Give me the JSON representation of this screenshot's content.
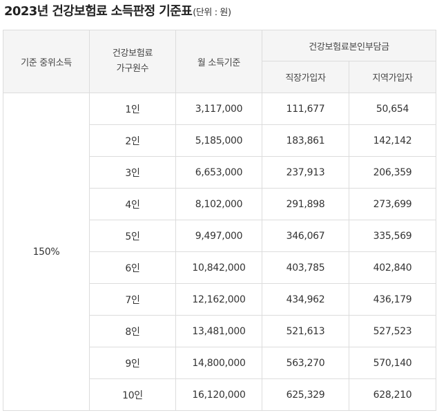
{
  "title": {
    "main": "2023년 건강보험료 소득판정 기준표",
    "unit": "(단위 : 원)"
  },
  "table": {
    "headers": {
      "median_income": "기준 중위소득",
      "household_line1": "건강보험료",
      "household_line2": "가구원수",
      "monthly_income": "월 소득기준",
      "premium_group": "건강보험료본인부담금",
      "employee": "직장가입자",
      "regional": "지역가입자"
    },
    "median_value": "150%",
    "rows": [
      {
        "members": "1인",
        "income": "3,117,000",
        "employee": "111,677",
        "regional": "50,654"
      },
      {
        "members": "2인",
        "income": "5,185,000",
        "employee": "183,861",
        "regional": "142,142"
      },
      {
        "members": "3인",
        "income": "6,653,000",
        "employee": "237,913",
        "regional": "206,359"
      },
      {
        "members": "4인",
        "income": "8,102,000",
        "employee": "291,898",
        "regional": "273,699"
      },
      {
        "members": "5인",
        "income": "9,497,000",
        "employee": "346,067",
        "regional": "335,569"
      },
      {
        "members": "6인",
        "income": "10,842,000",
        "employee": "403,785",
        "regional": "402,840"
      },
      {
        "members": "7인",
        "income": "12,162,000",
        "employee": "434,962",
        "regional": "436,179"
      },
      {
        "members": "8인",
        "income": "13,481,000",
        "employee": "521,613",
        "regional": "527,523"
      },
      {
        "members": "9인",
        "income": "14,800,000",
        "employee": "563,270",
        "regional": "570,140"
      },
      {
        "members": "10인",
        "income": "16,120,000",
        "employee": "625,329",
        "regional": "628,210"
      }
    ]
  },
  "colors": {
    "header_bg": "#f5f5f5",
    "border": "#dcdcdc",
    "title_highlight": "#b6e8e0"
  }
}
